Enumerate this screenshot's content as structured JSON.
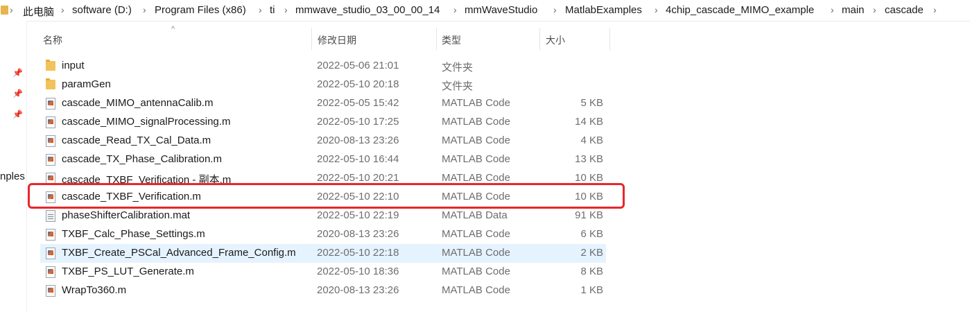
{
  "breadcrumb": [
    "此电脑",
    "software (D:)",
    "Program Files (x86)",
    "ti",
    "mmwave_studio_03_00_00_14",
    "mmWaveStudio",
    "MatlabExamples",
    "4chip_cascade_MIMO_example",
    "main",
    "cascade"
  ],
  "left_pane": {
    "partial_label": "nples"
  },
  "columns": {
    "name": "名称",
    "date": "修改日期",
    "type": "类型",
    "size": "大小"
  },
  "files": [
    {
      "name": "input",
      "date": "2022-05-06 21:01",
      "type": "文件夹",
      "size": "",
      "icon": "folder-icon"
    },
    {
      "name": "paramGen",
      "date": "2022-05-10 20:18",
      "type": "文件夹",
      "size": "",
      "icon": "folder-icon"
    },
    {
      "name": "cascade_MIMO_antennaCalib.m",
      "date": "2022-05-05 15:42",
      "type": "MATLAB Code",
      "size": "5 KB",
      "icon": "matlab-code-icon"
    },
    {
      "name": "cascade_MIMO_signalProcessing.m",
      "date": "2022-05-10 17:25",
      "type": "MATLAB Code",
      "size": "14 KB",
      "icon": "matlab-code-icon"
    },
    {
      "name": "cascade_Read_TX_Cal_Data.m",
      "date": "2020-08-13 23:26",
      "type": "MATLAB Code",
      "size": "4 KB",
      "icon": "matlab-code-icon"
    },
    {
      "name": "cascade_TX_Phase_Calibration.m",
      "date": "2022-05-10 16:44",
      "type": "MATLAB Code",
      "size": "13 KB",
      "icon": "matlab-code-icon"
    },
    {
      "name": "cascade_TXBF_Verification - 副本.m",
      "date": "2022-05-10 20:21",
      "type": "MATLAB Code",
      "size": "10 KB",
      "icon": "matlab-code-icon"
    },
    {
      "name": "cascade_TXBF_Verification.m",
      "date": "2022-05-10 22:10",
      "type": "MATLAB Code",
      "size": "10 KB",
      "icon": "matlab-code-icon"
    },
    {
      "name": "phaseShifterCalibration.mat",
      "date": "2022-05-10 22:19",
      "type": "MATLAB Data",
      "size": "91 KB",
      "icon": "matlab-data-icon"
    },
    {
      "name": "TXBF_Calc_Phase_Settings.m",
      "date": "2020-08-13 23:26",
      "type": "MATLAB Code",
      "size": "6 KB",
      "icon": "matlab-code-icon"
    },
    {
      "name": "TXBF_Create_PSCal_Advanced_Frame_Config.m",
      "date": "2022-05-10 22:18",
      "type": "MATLAB Code",
      "size": "2 KB",
      "icon": "matlab-code-icon"
    },
    {
      "name": "TXBF_PS_LUT_Generate.m",
      "date": "2022-05-10 18:36",
      "type": "MATLAB Code",
      "size": "8 KB",
      "icon": "matlab-code-icon"
    },
    {
      "name": "WrapTo360.m",
      "date": "2020-08-13 23:26",
      "type": "MATLAB Code",
      "size": "1 KB",
      "icon": "matlab-code-icon"
    }
  ],
  "colors": {
    "hover_row": "#e5f3ff",
    "highlight_box": "#e8262b",
    "folder": "#f2c35a"
  }
}
